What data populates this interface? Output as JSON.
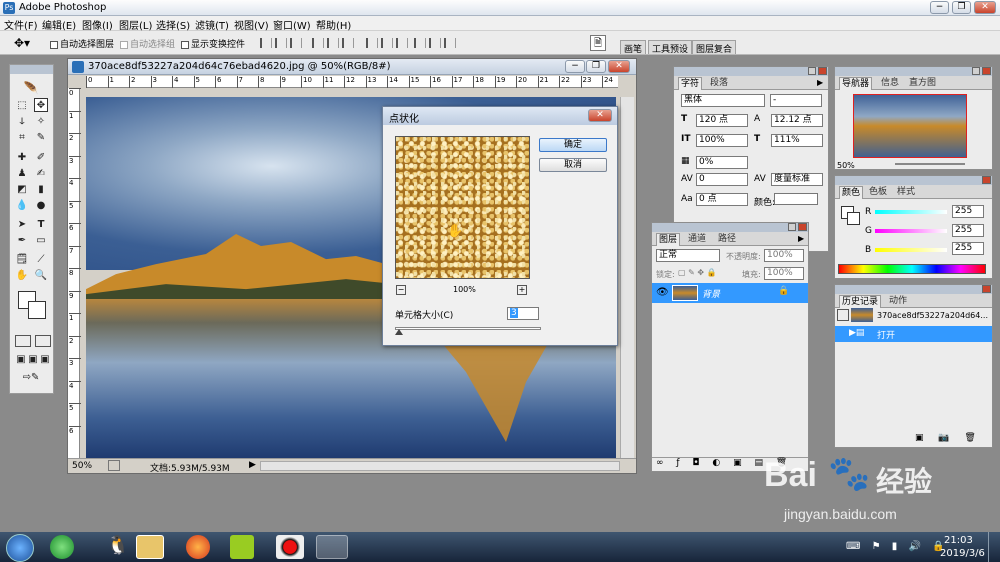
{
  "app": {
    "title": "Adobe Photoshop"
  },
  "window_controls": {
    "minimize": "−",
    "restore": "❐",
    "close": "✕"
  },
  "menu": [
    "文件(F)",
    "编辑(E)",
    "图像(I)",
    "图层(L)",
    "选择(S)",
    "滤镜(T)",
    "视图(V)",
    "窗口(W)",
    "帮助(H)"
  ],
  "options": {
    "auto_select_layer": "自动选择图层",
    "auto_select_group": "自动选择组",
    "show_transform": "显示变换控件"
  },
  "panel_tabs_top": [
    "画笔",
    "工具预设",
    "图层复合"
  ],
  "document": {
    "title": "370ace8df53227a204d64c76ebad4620.jpg @ 50%(RGB/8#)",
    "zoom": "50%",
    "doc_size": "文档:5.93M/5.93M",
    "ruler_marks_h": [
      "0",
      "1",
      "2",
      "3",
      "4",
      "5",
      "6",
      "7",
      "8",
      "9",
      "10",
      "11",
      "12",
      "13",
      "14",
      "15",
      "16",
      "17",
      "18",
      "19",
      "20",
      "21",
      "22",
      "23",
      "24"
    ],
    "ruler_marks_v": [
      "0",
      "1",
      "2",
      "3",
      "4",
      "5",
      "6",
      "7",
      "8",
      "9",
      "1",
      "2",
      "3",
      "4",
      "5",
      "6"
    ]
  },
  "dialog": {
    "title": "点状化",
    "ok": "确定",
    "cancel": "取消",
    "zoom_minus": "−",
    "zoom_value": "100%",
    "zoom_plus": "+",
    "cell_size_label": "单元格大小(C)",
    "cell_size_value": "3"
  },
  "character_panel": {
    "tabs": [
      "字符",
      "段落"
    ],
    "font": "黑体",
    "font_style": "-",
    "size": "120 点",
    "leading": "12.12 点",
    "vscale": "100%",
    "hscale": "111%",
    "tracking_pct": "0%",
    "kerning": "0",
    "kerning_mode": "度量标准",
    "baseline": "0 点",
    "color_label": "颜色:"
  },
  "navigator_panel": {
    "tabs": [
      "导航器",
      "信息",
      "直方图"
    ],
    "zoom": "50%"
  },
  "color_panel": {
    "tabs": [
      "颜色",
      "色板",
      "样式"
    ],
    "channels": [
      {
        "name": "R",
        "value": "255"
      },
      {
        "name": "G",
        "value": "255"
      },
      {
        "name": "B",
        "value": "255"
      }
    ]
  },
  "layers_panel": {
    "tabs": [
      "图层",
      "通道",
      "路径"
    ],
    "blend_mode": "正常",
    "opacity_label": "不透明度:",
    "opacity": "100%",
    "lock_label": "锁定:",
    "fill_label": "填充:",
    "fill": "100%",
    "layers": [
      {
        "name": "背景"
      }
    ]
  },
  "history_panel": {
    "tabs": [
      "历史记录",
      "动作"
    ],
    "snapshot": "370ace8df53227a204d64...",
    "items": [
      "打开"
    ]
  },
  "taskbar": {
    "time": "21:03",
    "date": "2019/3/6"
  },
  "watermark": {
    "brand": "Bai",
    "brand2": "经验",
    "url": "jingyan.baidu.com"
  },
  "colors": {
    "accent": "#3399ff",
    "sky": "#3b5f94",
    "gold": "#c88a2a"
  }
}
